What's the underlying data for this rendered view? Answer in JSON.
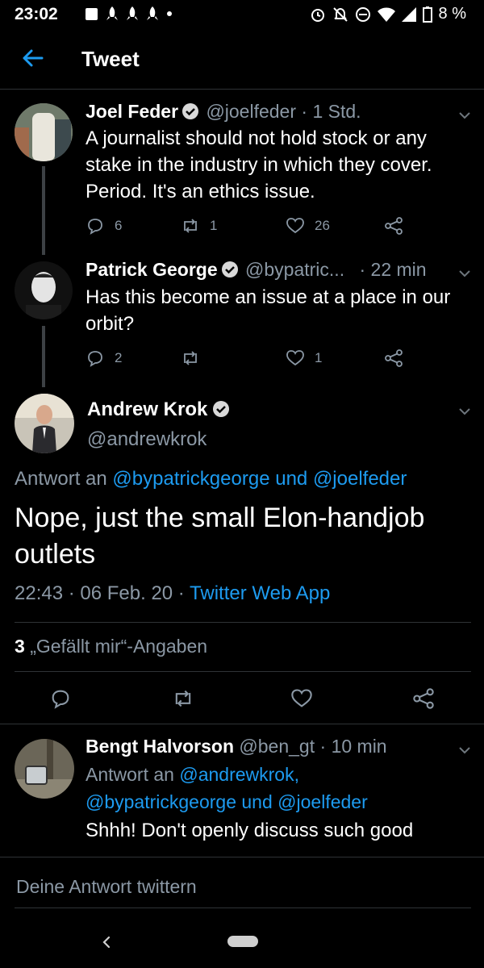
{
  "status_bar": {
    "time": "23:02",
    "battery": "8 %"
  },
  "header": {
    "title": "Tweet"
  },
  "thread": [
    {
      "name": "Joel Feder",
      "handle": "@joelfeder",
      "time": "· 1 Std.",
      "text": "A journalist should not hold stock or any stake in the industry in which they cover. Period. It's an ethics issue.",
      "replies": "6",
      "retweets": "1",
      "likes": "26"
    },
    {
      "name": "Patrick George",
      "handle": "@bypatric...",
      "time": "· 22 min",
      "text": "Has this become an issue at a place in our orbit?",
      "replies": "2",
      "retweets": "",
      "likes": "1"
    }
  ],
  "main_tweet": {
    "name": "Andrew Krok",
    "handle": "@andrewkrok",
    "reply_prefix": "Antwort an",
    "reply_mention_1": "@bypatrickgeorge",
    "reply_joiner": "und",
    "reply_mention_2": "@joelfeder",
    "text": "Nope, just the small Elon-handjob outlets",
    "date": "22:43 · 06 Feb. 20 ·",
    "source": "Twitter Web App",
    "likes_count": "3",
    "likes_label": "„Gefällt mir“-Angaben"
  },
  "reply": {
    "name": "Bengt Halvorson",
    "handle": "@ben_gt",
    "time": "· 10 min",
    "reply_prefix": "Antwort an",
    "mention_1": "@andrewkrok,",
    "mention_2": "@bypatrickgeorge",
    "joiner": "und",
    "mention_3": "@joelfeder",
    "text": "Shhh! Don't openly discuss such good"
  },
  "composer": {
    "placeholder": "Deine Antwort twittern"
  },
  "colors": {
    "accent": "#1d9bf0",
    "muted": "#8b98a5",
    "background": "#000000"
  }
}
